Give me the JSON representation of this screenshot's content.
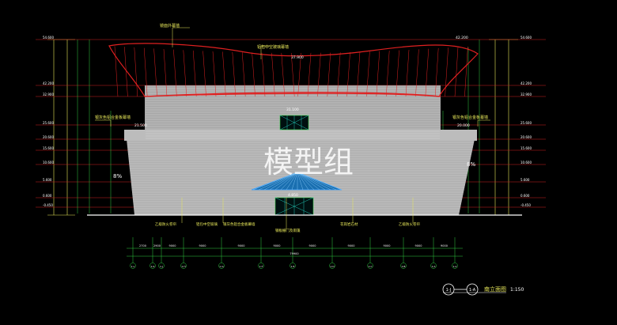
{
  "watermark": "模型组",
  "drawing": {
    "title": "南立面图",
    "scale": "1:150",
    "axis_from": "1-J",
    "axis_to": "1-A"
  },
  "elevations": {
    "left": [
      "54.600",
      "42.200",
      "32.900",
      "25.600",
      "20.600",
      "15.600",
      "10.600",
      "5.600",
      "0.600",
      "-0.450"
    ],
    "right": [
      "54.600",
      "42.200",
      "32.900",
      "25.600",
      "20.600",
      "15.600",
      "10.600",
      "5.600",
      "0.600",
      "-0.450"
    ],
    "roof_top": "42.200",
    "mid_roof": "37.900",
    "upper_block": "31.100",
    "podium_left": "21.500",
    "podium_right": "20.000",
    "entrance": "4.850"
  },
  "labels": {
    "roof_top": "镜面外幕墙",
    "roof_mid": "铝包中空玻璃幕墙",
    "left_podium": "银灰色铝合金板幕墙",
    "right_podium": "银灰色铝合金板幕墙",
    "slope_left": "8%",
    "slope_right": "8%",
    "bottom": [
      "乙级防火卷帘",
      "铝包中空玻璃",
      "银灰色铝合金板幕墙",
      "钢板栅门及雨篷",
      "花岗岩石材",
      "乙级防火卷帘"
    ]
  },
  "dimensions": [
    "2700",
    "2900",
    "9000",
    "9000",
    "9000",
    "9000",
    "9000",
    "9000",
    "9000",
    "9000",
    "9000",
    "2700"
  ],
  "total_dimension": "79900",
  "axis_labels": [
    "1-L",
    "1-K",
    "1-J",
    "1-H",
    "1-G",
    "1-F",
    "1-E",
    "1-D",
    "1-C",
    "1-B",
    "1-A",
    "1-A",
    "1-A"
  ]
}
